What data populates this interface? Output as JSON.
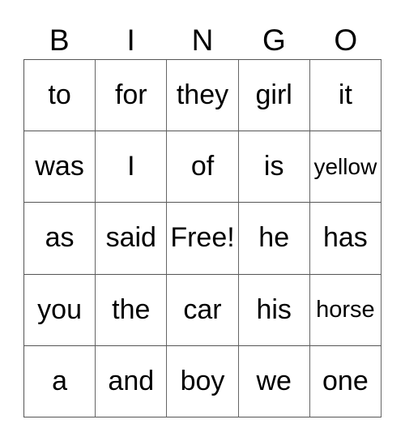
{
  "header": [
    "B",
    "I",
    "N",
    "G",
    "O"
  ],
  "rows": [
    [
      "to",
      "for",
      "they",
      "girl",
      "it"
    ],
    [
      "was",
      "I",
      "of",
      "is",
      "yellow"
    ],
    [
      "as",
      "said",
      "Free!",
      "he",
      "has"
    ],
    [
      "you",
      "the",
      "car",
      "his",
      "horse"
    ],
    [
      "a",
      "and",
      "boy",
      "we",
      "one"
    ]
  ]
}
